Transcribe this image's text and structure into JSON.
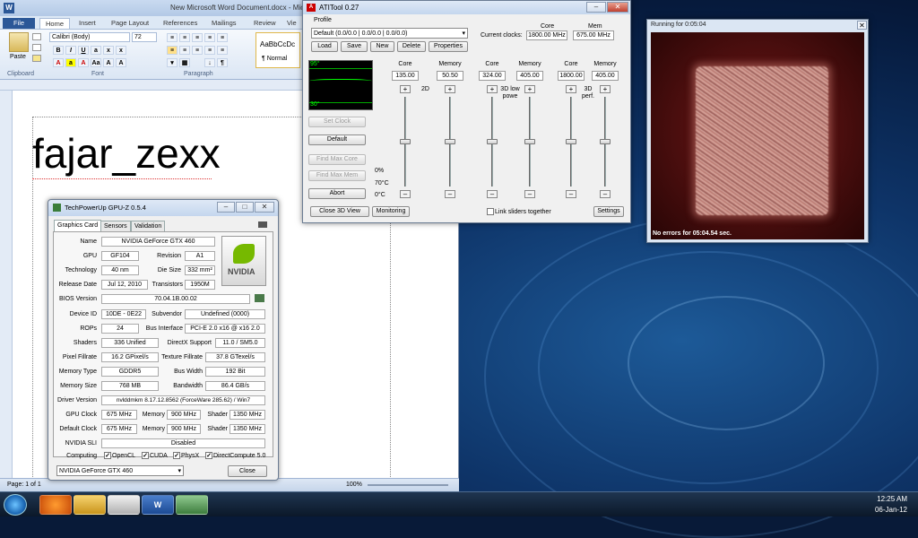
{
  "word": {
    "title": "New Microsoft Word Document.docx - Microsoft W",
    "app_icon": "W",
    "tabs": [
      "File",
      "Home",
      "Insert",
      "Page Layout",
      "References",
      "Mailings",
      "Review",
      "Vie"
    ],
    "font_name": "Calibri (Body)",
    "font_size": "72",
    "paste_label": "Paste",
    "style_preview": "AaBbCcDc",
    "style_name": "¶ Normal",
    "groups": [
      "Clipboard",
      "Font",
      "Paragraph"
    ],
    "document_text": "fajar_zexx",
    "status_page": "Page: 1 of 1",
    "zoom": "100%"
  },
  "gpuz": {
    "title": "TechPowerUp GPU-Z 0.5.4",
    "tabs": [
      "Graphics Card",
      "Sensors",
      "Validation"
    ],
    "fields": {
      "name_label": "Name",
      "name": "NVIDIA GeForce GTX 460",
      "gpu_label": "GPU",
      "gpu": "GF104",
      "revision_label": "Revision",
      "revision": "A1",
      "technology_label": "Technology",
      "technology": "40 nm",
      "die_size_label": "Die Size",
      "die_size": "332 mm²",
      "release_label": "Release Date",
      "release": "Jul 12, 2010",
      "transistors_label": "Transistors",
      "transistors": "1950M",
      "bios_label": "BIOS Version",
      "bios": "70.04.1B.00.02",
      "device_label": "Device ID",
      "device": "10DE - 0E22",
      "subvendor_label": "Subvendor",
      "subvendor": "Undefined (0000)",
      "rops_label": "ROPs",
      "rops": "24",
      "bus_label": "Bus Interface",
      "bus": "PCI-E 2.0 x16 @ x16 2.0",
      "shaders_label": "Shaders",
      "shaders": "336 Unified",
      "directx_label": "DirectX Support",
      "directx": "11.0 / SM5.0",
      "pixel_label": "Pixel Fillrate",
      "pixel": "16.2 GPixel/s",
      "texture_label": "Texture Fillrate",
      "texture": "37.8 GTexel/s",
      "memtype_label": "Memory Type",
      "memtype": "GDDR5",
      "buswidth_label": "Bus Width",
      "buswidth": "192 Bit",
      "memsize_label": "Memory Size",
      "memsize": "768 MB",
      "bandwidth_label": "Bandwidth",
      "bandwidth": "86.4 GB/s",
      "driver_label": "Driver Version",
      "driver": "nvlddmkm 8.17.12.8562 (ForceWare 285.62) / Win7",
      "gpuclock_label": "GPU Clock",
      "gpuclock": "675 MHz",
      "memory_label": "Memory",
      "gpuclock_mem": "900 MHz",
      "shader_label": "Shader",
      "gpuclock_shader": "1350 MHz",
      "defclock_label": "Default Clock",
      "defclock": "675 MHz",
      "defclock_mem": "900 MHz",
      "defclock_shader": "1350 MHz",
      "sli_label": "NVIDIA SLI",
      "sli": "Disabled",
      "computing_label": "Computing"
    },
    "computing": [
      "OpenCL",
      "CUDA",
      "PhysX",
      "DirectCompute 5.0"
    ],
    "logo_text": "NVIDIA",
    "selected_card": "NVIDIA GeForce GTX 460",
    "close_label": "Close"
  },
  "ati": {
    "title": "ATITool 0.27",
    "profile_label": "Profile",
    "profile_value": "Default (0.0/0.0 | 0.0/0.0 | 0.0/0.0)",
    "current_clocks_label": "Current clocks:",
    "core_header": "Core",
    "mem_header": "Mem",
    "current_core": "1800.00 MHz",
    "current_mem": "675.00 MHz",
    "buttons": {
      "load": "Load",
      "save": "Save",
      "new": "New",
      "delete": "Delete",
      "properties": "Properties"
    },
    "graph_top": "95°",
    "graph_bottom": "30°",
    "left_buttons": {
      "set_clock": "Set Clock",
      "default": "Default",
      "find_core": "Find Max Core",
      "find_mem": "Find Max Mem",
      "abort": "Abort",
      "close3d": "Close 3D View",
      "monitoring": "Monitoring",
      "settings": "Settings"
    },
    "temps": {
      "pct": "0%",
      "t1": "70°C",
      "t2": "0°C"
    },
    "sliders": [
      {
        "label": "Core",
        "value": "135.00"
      },
      {
        "label": "Memory",
        "value": "50.50"
      },
      {
        "label": "Core",
        "value": "324.00"
      },
      {
        "label": "Memory",
        "value": "405.00"
      },
      {
        "label": "Core",
        "value": "1800.00"
      },
      {
        "label": "Memory",
        "value": "405.00"
      }
    ],
    "mode_labels": [
      "2D",
      "3D low powe",
      "3D perf."
    ],
    "link_label": "Link sliders together"
  },
  "run": {
    "title": "Running for 0:05:04",
    "status": "No errors for 05:04.54 sec."
  },
  "taskbar": {
    "time": "12:25 AM",
    "date": "06-Jan-12"
  }
}
